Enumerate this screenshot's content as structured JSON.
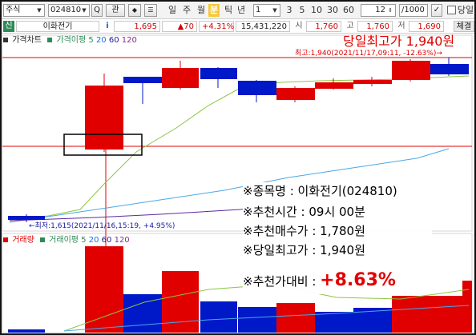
{
  "toolbar": {
    "type_select": "주식",
    "code_input": "024810",
    "search_btn": "Q",
    "interest_btn": "관",
    "period_labels": [
      "일",
      "주",
      "월",
      "분",
      "틱",
      "년"
    ],
    "active_period": "분",
    "unit_select": "1",
    "tick_buttons": [
      "3",
      "5",
      "10",
      "30",
      "60"
    ],
    "count_input": "12",
    "total_count": "/1000",
    "same_day_label": "당일"
  },
  "quote": {
    "tag": "신",
    "name": "이화전기",
    "info_icon": "i",
    "price": "1,695",
    "change": "▲70",
    "change_pct": "+4.31%",
    "volume": "15,431,220",
    "high_label": "시",
    "high": "1,760",
    "low_label": "고",
    "low": "1,760",
    "open_label": "저",
    "open": "1,690",
    "last_label": "체결"
  },
  "chart": {
    "price_tab": "가격차트",
    "ma_label": "가격이평",
    "ma_periods": [
      "5",
      "20",
      "60",
      "120"
    ],
    "high_annotation": "당일최고가 1,940원",
    "high_marker": "최고:1,940(2021/11/17,09:11, -12.63%)→",
    "low_marker": "←최저:1,615(2021/11/16,15:19, +4.95%)",
    "volume_tab": "거래량",
    "volume_ma_label": "거래이평",
    "volume_ma_periods": [
      "5",
      "20",
      "60",
      "120"
    ],
    "colors": {
      "up": "#e00000",
      "down": "#0019c8",
      "ma5": "#8cc63f",
      "ma20": "#4aa7e8",
      "ma60": "#5b2aa0"
    }
  },
  "info_box": {
    "stock": "※종목명 : 이화전기(024810)",
    "time": "※추천시간 : 09시 00분",
    "buy_price": "※추천매수가 : 1,780원",
    "day_high": "※당일최고가 : 1,940원",
    "ratio_label": "※추천가대비 :",
    "ratio_value": "+8.63%"
  }
}
